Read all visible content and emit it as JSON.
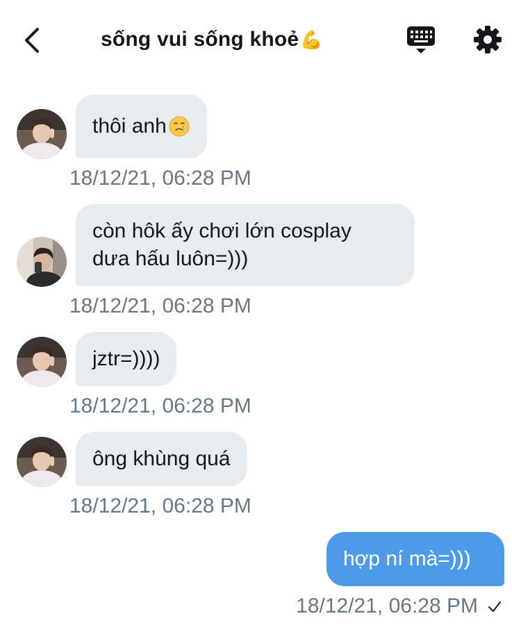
{
  "header": {
    "title": "sống vui sống khoẻ",
    "title_emoji": "💪",
    "back_icon": "chevron-left-icon",
    "keyboard_icon": "keyboard-icon",
    "settings_icon": "gear-icon"
  },
  "messages": [
    {
      "direction": "incoming",
      "avatar": "avatar-user-a",
      "text": "thôi anh",
      "emoji": "🥲",
      "timestamp": "18/12/21, 06:28 PM"
    },
    {
      "direction": "incoming",
      "avatar": "avatar-user-b",
      "line1": "còn hôk ấy chơi lớn cosplay",
      "line2": "dưa hấu luôn=)))",
      "timestamp": "18/12/21, 06:28 PM"
    },
    {
      "direction": "incoming",
      "avatar": "avatar-user-a",
      "text": "jztr=))))",
      "timestamp": "18/12/21, 06:28 PM"
    },
    {
      "direction": "incoming",
      "avatar": "avatar-user-a",
      "text": "ông khùng quá",
      "timestamp": "18/12/21, 06:28 PM"
    },
    {
      "direction": "outgoing",
      "text": "hợp ní mà=)))",
      "timestamp": "18/12/21, 06:28 PM",
      "status_icon": "checkmark-icon"
    }
  ],
  "colors": {
    "incoming_bubble": "#e6ecf0",
    "outgoing_bubble": "#4d9be8",
    "timestamp": "#657786",
    "text": "#14171a"
  }
}
